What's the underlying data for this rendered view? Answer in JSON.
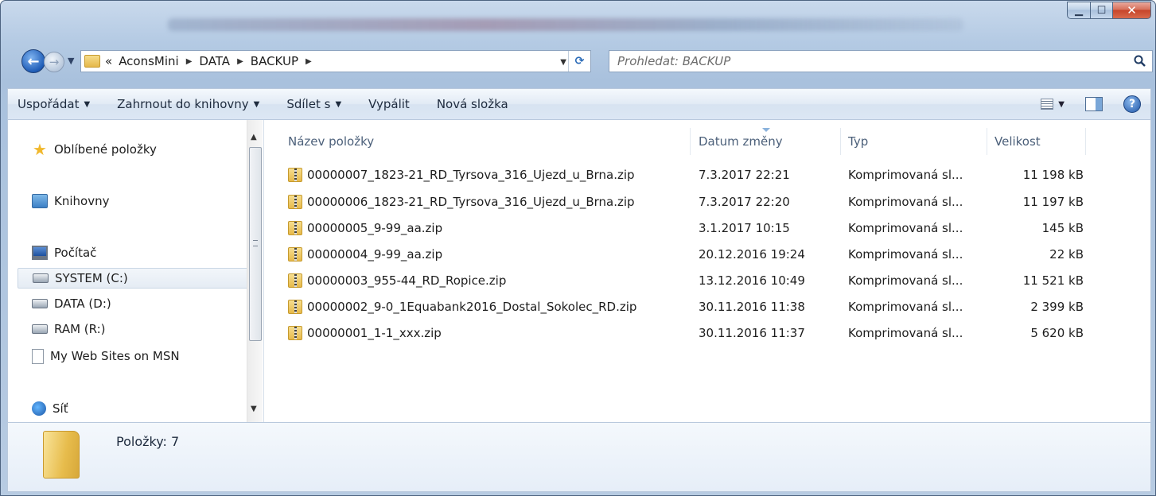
{
  "address": {
    "overflow": "«",
    "crumbs": [
      "AconsMini",
      "DATA",
      "BACKUP"
    ]
  },
  "search": {
    "placeholder": "Prohledat: BACKUP"
  },
  "toolbar": {
    "organize": "Uspořádat",
    "include_library": "Zahrnout do knihovny",
    "share": "Sdílet s",
    "burn": "Vypálit",
    "new_folder": "Nová složka"
  },
  "nav": {
    "favorites": "Oblíbené položky",
    "libraries": "Knihovny",
    "computer": "Počítač",
    "system_c": "SYSTEM (C:)",
    "data_d": "DATA (D:)",
    "ram_r": "RAM (R:)",
    "msn": "My Web Sites on MSN",
    "network": "Síť"
  },
  "columns": {
    "name": "Název položky",
    "date": "Datum změny",
    "type": "Typ",
    "size": "Velikost"
  },
  "files": [
    {
      "name": "00000007_1823-21_RD_Tyrsova_316_Ujezd_u_Brna.zip",
      "date": "7.3.2017 22:21",
      "type": "Komprimovaná sl...",
      "size": "11 198 kB"
    },
    {
      "name": "00000006_1823-21_RD_Tyrsova_316_Ujezd_u_Brna.zip",
      "date": "7.3.2017 22:20",
      "type": "Komprimovaná sl...",
      "size": "11 197 kB"
    },
    {
      "name": "00000005_9-99_aa.zip",
      "date": "3.1.2017 10:15",
      "type": "Komprimovaná sl...",
      "size": "145 kB"
    },
    {
      "name": "00000004_9-99_aa.zip",
      "date": "20.12.2016 19:24",
      "type": "Komprimovaná sl...",
      "size": "22 kB"
    },
    {
      "name": "00000003_955-44_RD_Ropice.zip",
      "date": "13.12.2016 10:49",
      "type": "Komprimovaná sl...",
      "size": "11 521 kB"
    },
    {
      "name": "00000002_9-0_1Equabank2016_Dostal_Sokolec_RD.zip",
      "date": "30.11.2016 11:38",
      "type": "Komprimovaná sl...",
      "size": "2 399 kB"
    },
    {
      "name": "00000001_1-1_xxx.zip",
      "date": "30.11.2016 11:37",
      "type": "Komprimovaná sl...",
      "size": "5 620 kB"
    }
  ],
  "status": {
    "items": "Položky: 7"
  }
}
